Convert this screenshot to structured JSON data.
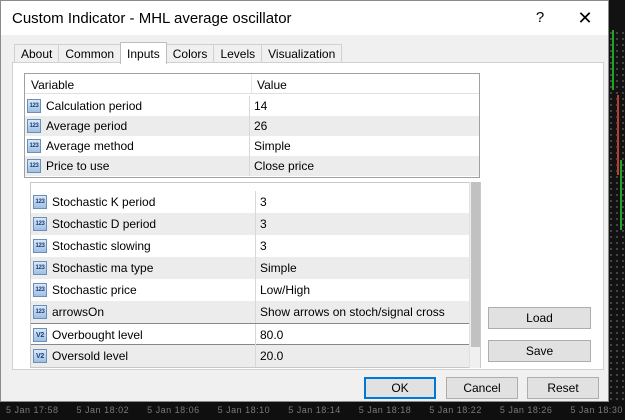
{
  "window": {
    "title": "Custom Indicator - MHL average oscillator",
    "help_label": "?",
    "close_label": "✕"
  },
  "tabs": [
    {
      "label": "About",
      "active": false
    },
    {
      "label": "Common",
      "active": false
    },
    {
      "label": "Inputs",
      "active": true
    },
    {
      "label": "Colors",
      "active": false
    },
    {
      "label": "Levels",
      "active": false
    },
    {
      "label": "Visualization",
      "active": false
    }
  ],
  "grid1": {
    "columns": [
      "Variable",
      "Value"
    ],
    "rows": [
      {
        "icon": "123",
        "name": "Calculation period",
        "value": "14"
      },
      {
        "icon": "123",
        "name": "Average period",
        "value": "26"
      },
      {
        "icon": "123",
        "name": "Average method",
        "value": "Simple"
      },
      {
        "icon": "123",
        "name": "Price to use",
        "value": "Close price"
      }
    ]
  },
  "grid2": {
    "rows": [
      {
        "icon": "123",
        "name": "Stochastic K period",
        "value": "3"
      },
      {
        "icon": "123",
        "name": "Stochastic D period",
        "value": "3"
      },
      {
        "icon": "123",
        "name": "Stochastic slowing",
        "value": "3"
      },
      {
        "icon": "123",
        "name": "Stochastic ma type",
        "value": "Simple"
      },
      {
        "icon": "123",
        "name": "Stochastic price",
        "value": "Low/High"
      },
      {
        "icon": "123",
        "name": "arrowsOn",
        "value": "Show arrows on stoch/signal cross"
      },
      {
        "icon": "V2",
        "name": "Overbought level",
        "value": "80.0"
      },
      {
        "icon": "V2",
        "name": "Oversold level",
        "value": "20.0"
      }
    ]
  },
  "buttons": {
    "load": "Load",
    "save": "Save",
    "ok": "OK",
    "cancel": "Cancel",
    "reset": "Reset"
  },
  "background_axis": [
    "5 Jan 17:58",
    "5 Jan 18:02",
    "5 Jan 18:06",
    "5 Jan 18:10",
    "5 Jan 18:14",
    "5 Jan 18:18",
    "5 Jan 18:22",
    "5 Jan 18:26",
    "5 Jan 18:30"
  ],
  "colors": {
    "accent": "#0078d7",
    "row_alt": "#ececec",
    "dialog_bg": "#f0f0f0"
  }
}
